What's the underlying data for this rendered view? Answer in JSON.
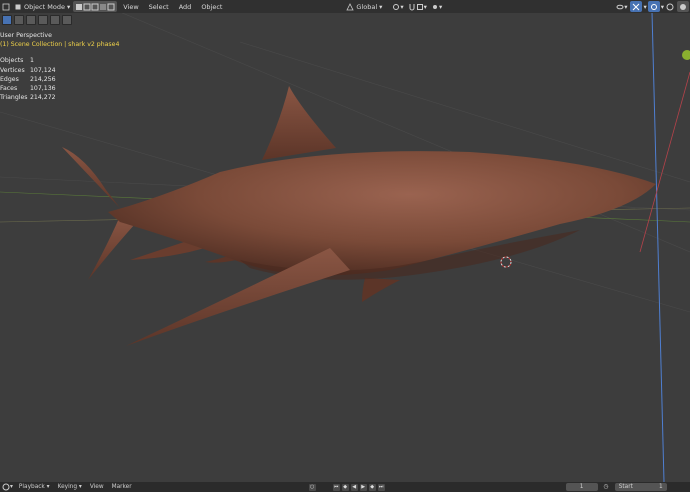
{
  "header": {
    "mode": "Object Mode",
    "menus": [
      "View",
      "Select",
      "Add",
      "Object"
    ],
    "orientation": "Global"
  },
  "overlay": {
    "perspective": "User Perspective",
    "collection": "(1) Scene Collection | shark v2 phase4",
    "stats": [
      {
        "label": "Objects",
        "value": "1"
      },
      {
        "label": "Vertices",
        "value": "107,124"
      },
      {
        "label": "Edges",
        "value": "214,256"
      },
      {
        "label": "Faces",
        "value": "107,136"
      },
      {
        "label": "Triangles",
        "value": "214,272"
      }
    ]
  },
  "timeline": {
    "menus": [
      "Playback",
      "Keying",
      "View",
      "Marker"
    ],
    "current_frame": "1",
    "start_label": "Start",
    "start_value": "1"
  },
  "colors": {
    "viewport_bg": "#3d3d3d",
    "header_bg": "#303030",
    "collection_text": "#f0d24a",
    "shark": "#7a4a38",
    "gizmo_green": "#8ab02f",
    "z_axis": "#4f7fd1",
    "x_axis": "#b5424a"
  }
}
